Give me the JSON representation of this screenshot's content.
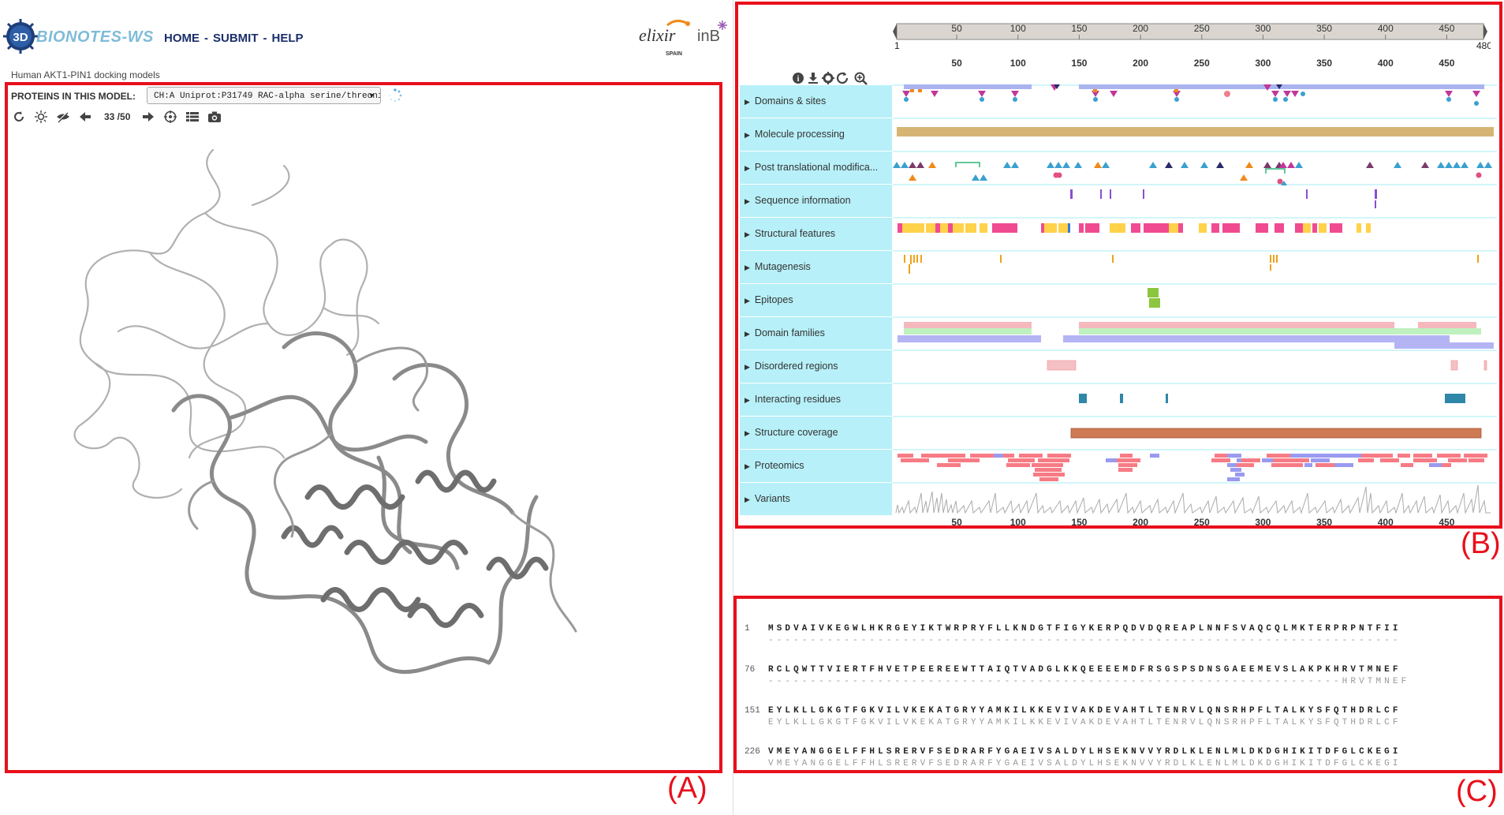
{
  "header": {
    "logo_prefix": "3D",
    "brand_name": "BIONOTES-WS",
    "nav": [
      "HOME",
      "SUBMIT",
      "HELP"
    ],
    "partner_logos": [
      "elixir",
      "SPAIN",
      "inB"
    ]
  },
  "subtitle": "Human AKT1-PIN1 docking models",
  "viewer": {
    "proteins_label": "PROTEINS IN THIS MODEL:",
    "protein_select_value": "CH:A Uniprot:P31749 RAC-alpha serine/threoni",
    "model_counter": "33 /50",
    "toolbar_icons": [
      "reset-icon",
      "light-icon",
      "eye-hide-icon",
      "previous-icon",
      "next-icon",
      "center-icon",
      "list-icon",
      "camera-icon"
    ],
    "molecule_color": "#9a9a9a"
  },
  "labels": {
    "a": "(A)",
    "b": "(B)",
    "c": "(C)"
  },
  "feature_viewer": {
    "range_start": "1",
    "range_end": "480",
    "ticks": [
      "50",
      "100",
      "150",
      "200",
      "250",
      "300",
      "350",
      "400",
      "450"
    ],
    "tools": [
      "info-icon",
      "download-icon",
      "settings-icon",
      "refresh-icon",
      "zoom-icon"
    ],
    "tracks": [
      {
        "label": "Domains & sites"
      },
      {
        "label": "Molecule processing"
      },
      {
        "label": "Post translational modifica..."
      },
      {
        "label": "Sequence information"
      },
      {
        "label": "Structural features"
      },
      {
        "label": "Mutagenesis"
      },
      {
        "label": "Epitopes"
      },
      {
        "label": "Domain families"
      },
      {
        "label": "Disordered regions"
      },
      {
        "label": "Interacting residues"
      },
      {
        "label": "Structure coverage"
      },
      {
        "label": "Proteomics"
      },
      {
        "label": "Variants"
      }
    ],
    "label_bg": "#b7f0f8"
  },
  "sequence": {
    "rows": [
      {
        "num": "1",
        "top": "MSDVAIVKEGWLHKRGEYIKTWRPRYFLLKNDGTFIGYKERPQDVDQREAPLNNFSVAQCQLMKTERPRPNTFII",
        "sub": "---------------------------------------------------------------------------"
      },
      {
        "num": "76",
        "top": "RCLQWTTVIERTFHVETPEEREEWTTAIQTVADGLKKQEEEEMDFRSGSPSDNSGAEEMEVSLAKPKHRVTMNEF",
        "sub": "--------------------------------------------------------------------HRVTMNEF"
      },
      {
        "num": "151",
        "top": "EYLKLLGKGTFGKVILVKEKATGRYYAMKILKKEVIVAKDEVAHTLTENRVLQNSRHPFLTALKYSFQTHDRLCF",
        "sub": "EYLKLLGKGTFGKVILVKEKATGRYYAMKILKKEVIVAKDEVAHTLTENRVLQNSRHPFLTALKYSFQTHDRLCF"
      },
      {
        "num": "226",
        "top": "VMEYANGGELFFHLSRERVFSEDRARFYGAEIVSALDYLHSEKNVVYRDLKLENLMLDKDGHIKITDFGLCKEGI",
        "sub": "VMEYANGGELFFHLSRERVFSEDRARFYGAEIVSALDYLHSEKNVVYRDLKLENLMLDKDGHIKITDFGLCKEGI"
      }
    ]
  }
}
